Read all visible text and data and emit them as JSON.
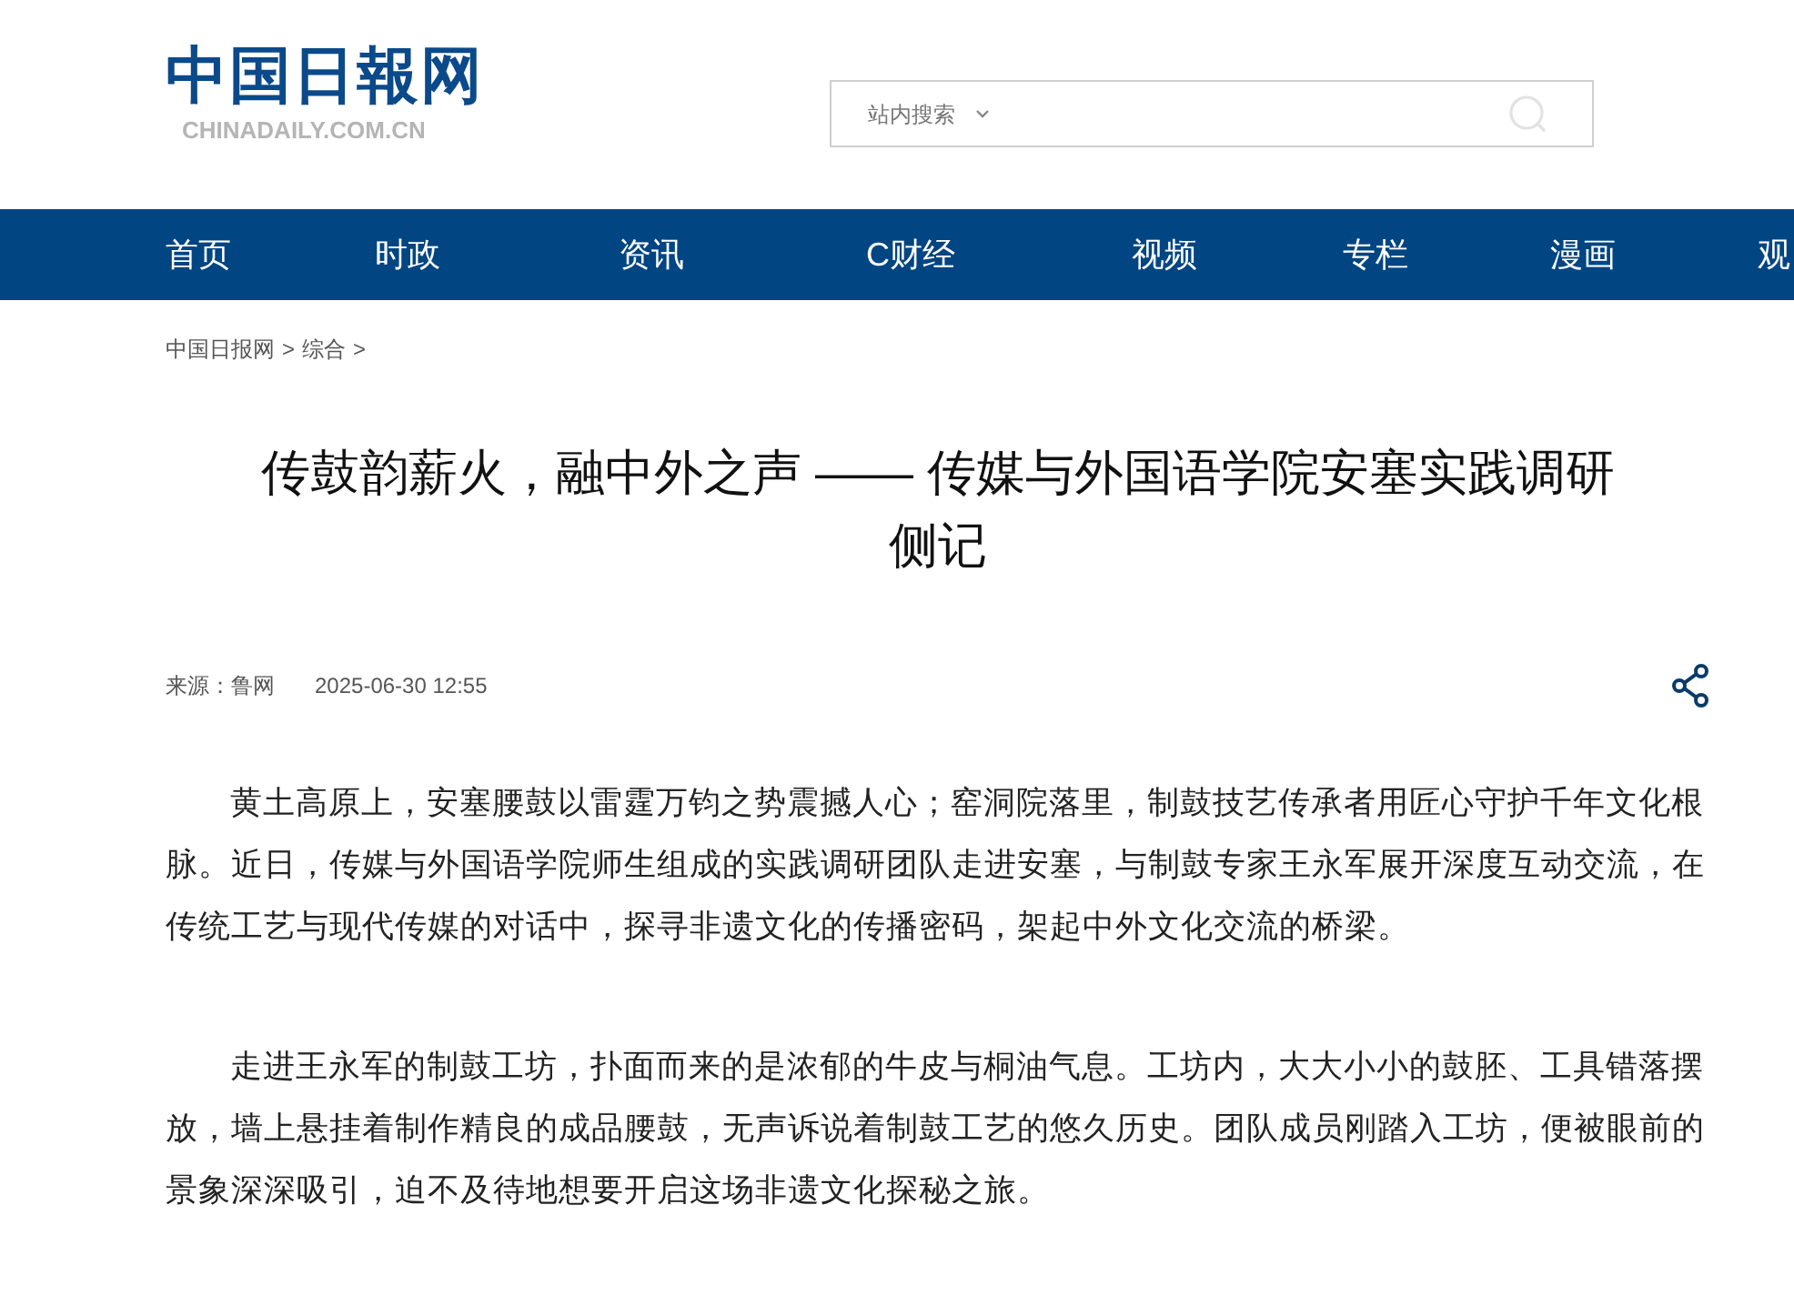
{
  "header": {
    "logo": "中国日報网",
    "logo_domain": "CHINADAILY.COM.CN",
    "search": {
      "scope": "站内搜索"
    }
  },
  "nav": [
    {
      "label": "首页"
    },
    {
      "label": "时政"
    },
    {
      "label": "资讯"
    },
    {
      "label": "C财经"
    },
    {
      "label": "视频"
    },
    {
      "label": "专栏"
    },
    {
      "label": "漫画"
    },
    {
      "label": "观"
    }
  ],
  "breadcrumb": [
    {
      "label": "中国日报网",
      "separator": ">"
    },
    {
      "label": "综合",
      "separator": ">"
    }
  ],
  "article": {
    "title": "传鼓韵薪火，融中外之声 —— 传媒与外国语学院安塞实践调研侧记",
    "source": "来源：鲁网",
    "date": "2025-06-30 12:55",
    "paragraphs": [
      "黄土高原上，安塞腰鼓以雷霆万钧之势震撼人心；窑洞院落里，制鼓技艺传承者用匠心守护千年文化根脉。近日，传媒与外国语学院师生组成的实践调研团队走进安塞，与制鼓专家王永军展开深度互动交流，在传统工艺与现代传媒的对话中，探寻非遗文化的传播密码，架起中外文化交流的桥梁。",
      "走进王永军的制鼓工坊，扑面而来的是浓郁的牛皮与桐油气息。工坊内，大大小小的鼓胚、工具错落摆放，墙上悬挂着制作精良的成品腰鼓，无声诉说着制鼓工艺的悠久历史。团队成员刚踏入工坊，便被眼前的景象深深吸引，迫不及待地想要开启这场非遗文化探秘之旅。"
    ]
  }
}
